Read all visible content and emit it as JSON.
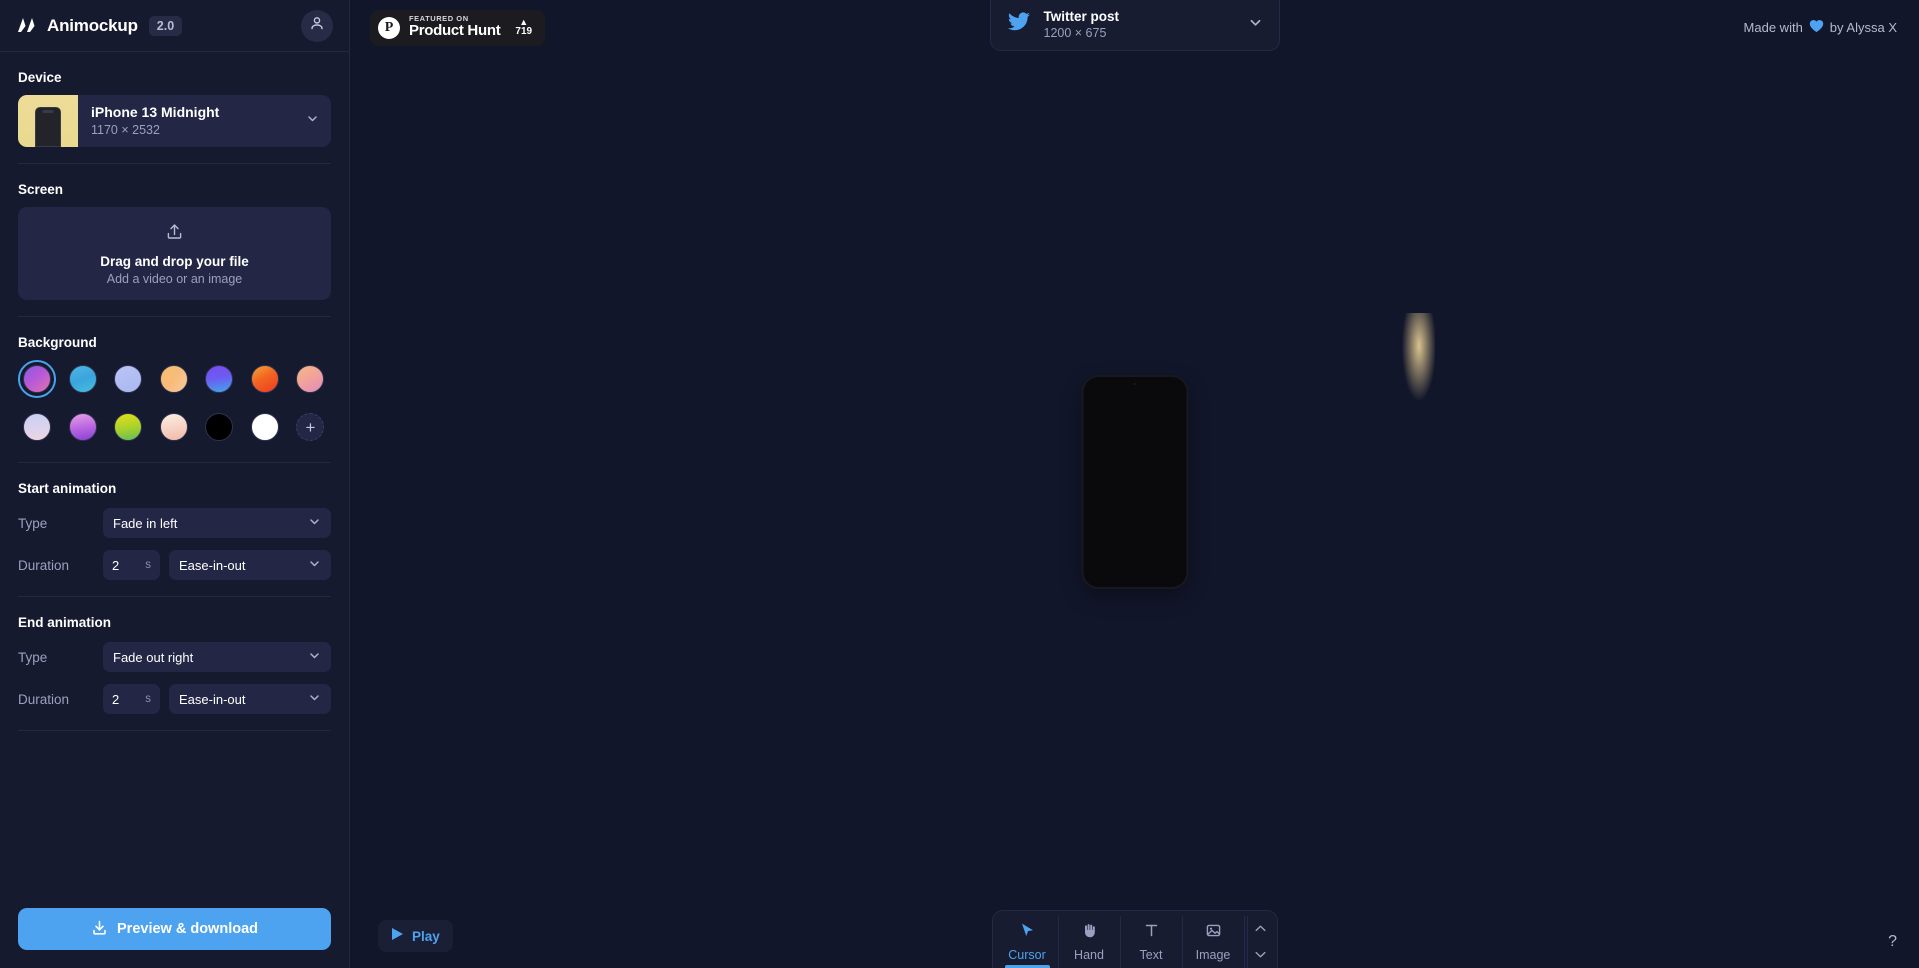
{
  "app": {
    "brand": "Animockup",
    "version": "2.0",
    "avatar_icon": "user-icon"
  },
  "sidebar": {
    "device_section": {
      "title": "Device",
      "name": "iPhone 13 Midnight",
      "resolution": "1170 × 2532",
      "chevron_icon": "chevron-down-icon"
    },
    "screen_section": {
      "title": "Screen",
      "upload_icon": "upload-icon",
      "drop_title": "Drag and drop your file",
      "drop_subtitle": "Add a video or an image"
    },
    "background_section": {
      "title": "Background",
      "selected_index": 0,
      "add_label": "+",
      "swatches": [
        {
          "name": "purple-magenta-gradient",
          "css": "linear-gradient(140deg,#8a5ce0 0%,#b558d8 45%,#e074ae 100%)"
        },
        {
          "name": "blue-teal-gradient",
          "css": "linear-gradient(160deg,#4fb6e6 0%,#3aa4dd 50%,#45c0dd 100%)"
        },
        {
          "name": "periwinkle-gradient",
          "css": "linear-gradient(160deg,#b9c4f4 0%,#aab8f2 100%)"
        },
        {
          "name": "peach-orange-gradient",
          "css": "linear-gradient(120deg,#f6c06c 0%,#f7bb79 45%,#f9c99a 100%)"
        },
        {
          "name": "violet-blue-gradient",
          "css": "linear-gradient(170deg,#7a4bf0 0%,#6d5bf2 45%,#3fa7e8 100%)"
        },
        {
          "name": "orange-red-gradient",
          "css": "linear-gradient(150deg,#f6a53a 0%,#f26522 45%,#ef3b22 100%)"
        },
        {
          "name": "pink-peach-gradient",
          "css": "linear-gradient(150deg,#f6b980 0%,#f09f9f 55%,#e08bbd 100%)"
        },
        {
          "name": "lilac-pink-gradient",
          "css": "linear-gradient(170deg,#c8cff2 0%,#dcd3ee 55%,#f0d6dc 100%)"
        },
        {
          "name": "purple-pink-gradient",
          "css": "linear-gradient(170deg,#e79fe6 0%,#b664e0 55%,#8a3fd4 100%)"
        },
        {
          "name": "yellow-green-gradient",
          "css": "linear-gradient(170deg,#e4e018 0%,#a8d12c 55%,#5fbc5c 100%)"
        },
        {
          "name": "cream-salmon-gradient",
          "css": "linear-gradient(170deg,#fbeee3 0%,#f6cfc0 60%,#f3b8a6 100%)"
        },
        {
          "name": "black-solid",
          "css": "#000000"
        },
        {
          "name": "white-solid",
          "css": "#ffffff"
        }
      ]
    },
    "start_animation": {
      "title": "Start animation",
      "type_label": "Type",
      "type_value": "Fade in left",
      "duration_label": "Duration",
      "duration_value": "2",
      "duration_unit": "s",
      "easing_value": "Ease-in-out"
    },
    "end_animation": {
      "title": "End animation",
      "type_label": "Type",
      "type_value": "Fade out right",
      "duration_label": "Duration",
      "duration_value": "2",
      "duration_unit": "s",
      "easing_value": "Ease-in-out"
    },
    "footer": {
      "download_icon": "download-icon",
      "download_label": "Preview & download",
      "accent": "#4da3ef"
    }
  },
  "topbar": {
    "product_hunt": {
      "logo_letter": "P",
      "featured_text": "FEATURED ON",
      "product_text": "Product Hunt",
      "upvote_icon": "triangle-up-icon",
      "upvote_count": "719"
    },
    "format": {
      "icon": "twitter-icon",
      "name": "Twitter post",
      "resolution": "1200 × 675",
      "chevron_icon": "chevron-down-icon"
    },
    "credit": {
      "prefix": "Made with",
      "heart_icon": "heart-icon",
      "suffix": "by Alyssa X",
      "heart_color": "#4da3ef"
    }
  },
  "canvas": {
    "artboard_name": "mockup-artboard",
    "phone_name": "iphone-13-mockup",
    "gradient": "linear-gradient(118deg,#4163d8 0%,#6b4fd6 26%,#a74bd2 48%,#e249c7 66%,#f06bb4 80%,#f7a987 94%)"
  },
  "bottom": {
    "play_icon": "play-icon",
    "play_label": "Play",
    "tools": [
      {
        "label": "Cursor",
        "icon": "cursor-icon",
        "active": true
      },
      {
        "label": "Hand",
        "icon": "hand-icon",
        "active": false
      },
      {
        "label": "Text",
        "icon": "text-icon",
        "active": false
      },
      {
        "label": "Image",
        "icon": "image-icon",
        "active": false
      }
    ],
    "stepper_up_icon": "chevron-up-icon",
    "stepper_down_icon": "chevron-down-icon",
    "help_label": "?"
  }
}
